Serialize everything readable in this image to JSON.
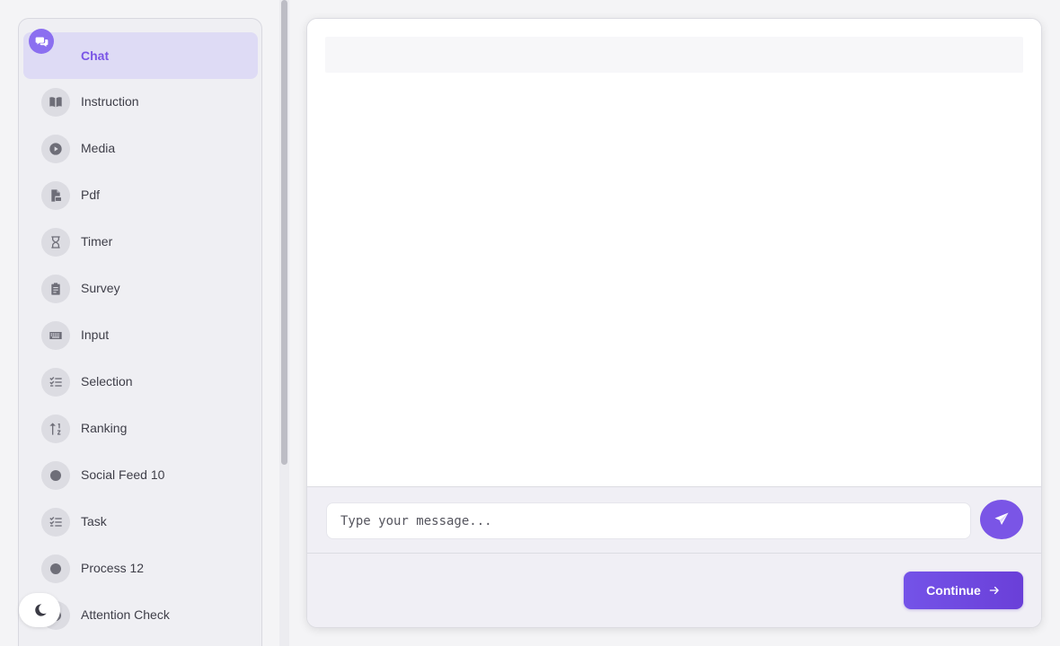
{
  "sidebar": {
    "items": [
      {
        "label": "Chat",
        "icon": "chat-icon",
        "active": true
      },
      {
        "label": "Instruction",
        "icon": "book-icon"
      },
      {
        "label": "Media",
        "icon": "play-icon"
      },
      {
        "label": "Pdf",
        "icon": "pdf-file-icon"
      },
      {
        "label": "Timer",
        "icon": "hourglass-icon"
      },
      {
        "label": "Survey",
        "icon": "clipboard-icon"
      },
      {
        "label": "Input",
        "icon": "keyboard-icon"
      },
      {
        "label": "Selection",
        "icon": "checklist-icon"
      },
      {
        "label": "Ranking",
        "icon": "sort-icon"
      },
      {
        "label": "Social Feed 10",
        "icon": "circle-icon"
      },
      {
        "label": "Task",
        "icon": "checklist-icon"
      },
      {
        "label": "Process 12",
        "icon": "circle-icon"
      },
      {
        "label": "Attention Check",
        "icon": "circle-icon"
      }
    ]
  },
  "theme_toggle": {
    "icon": "moon-icon"
  },
  "composer": {
    "placeholder": "Type your message...",
    "send_icon": "send-icon"
  },
  "footer": {
    "continue_label": "Continue",
    "continue_icon": "arrow-right-icon"
  },
  "colors": {
    "accent": "#7a55e6",
    "active_item_bg": "#dedbf5"
  }
}
